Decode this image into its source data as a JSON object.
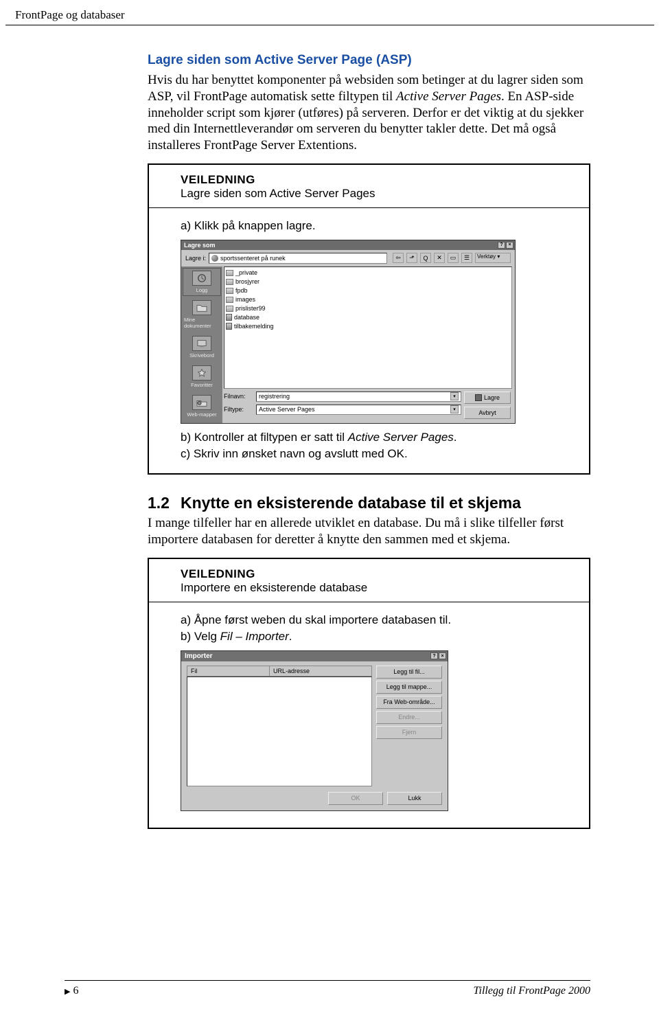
{
  "header": {
    "title": "FrontPage og databaser"
  },
  "section_asp": {
    "title": "Lagre siden som Active Server Page (ASP)",
    "para1_a": "Hvis du har benyttet komponenter på websiden som betinger at du lagrer siden som ASP, vil FrontPage automatisk sette filtypen til ",
    "para1_italic": "Active Server Pages",
    "para1_b": ". En ASP-side inneholder script som kjører (utføres) på serveren. Derfor er det viktig at du sjekker med din Internettleverandør om serveren du benytter takler dette. Det må også installeres FrontPage Server Extentions."
  },
  "box1": {
    "label": "VEILEDNING",
    "subtitle": "Lagre siden som Active Server Pages",
    "step_a": "a)  Klikk på knappen lagre.",
    "step_b_pre": "b)  Kontroller at filtypen er satt til ",
    "step_b_italic": "Active Server Pages",
    "step_b_post": ".",
    "step_c": "c)  Skriv inn ønsket navn og avslutt med OK."
  },
  "save_dialog": {
    "title": "Lagre som",
    "label_lagre_i": "Lagre i:",
    "dropdown_text": "sportssenteret på runek",
    "verktoy": "Verktøy ▾",
    "files": [
      {
        "type": "folder",
        "name": "_private"
      },
      {
        "type": "folder",
        "name": "brosjyrer"
      },
      {
        "type": "folder",
        "name": "fpdb"
      },
      {
        "type": "folder",
        "name": "images"
      },
      {
        "type": "folder",
        "name": "prislister99"
      },
      {
        "type": "db",
        "name": "database"
      },
      {
        "type": "db",
        "name": "tilbakemelding"
      }
    ],
    "sidebar": [
      "Logg",
      "Mine dokumenter",
      "Skrivebord",
      "Favoritter",
      "Web-mapper"
    ],
    "label_filnavn": "Filnavn:",
    "filnavn_value": "registrering",
    "label_filtype": "Filtype:",
    "filtype_value": "Active Server Pages",
    "btn_lagre": "Lagre",
    "btn_avbryt": "Avbryt"
  },
  "section_12": {
    "number": "1.2",
    "title": "Knytte en eksisterende database til et skjema",
    "para": "I mange tilfeller har en allerede utviklet en database. Du må i slike tilfeller først importere databasen for deretter å knytte den sammen med et skjema."
  },
  "box2": {
    "label": "VEILEDNING",
    "subtitle": "Importere en eksisterende database",
    "step_a": "a)  Åpne først weben du skal importere databasen til.",
    "step_b_pre": "b)  Velg ",
    "step_b_italic": "Fil – Importer",
    "step_b_post": "."
  },
  "import_dialog": {
    "title": "Importer",
    "col_fil": "Fil",
    "col_url": "URL-adresse",
    "btn_legg_fil": "Legg til fil...",
    "btn_legg_mappe": "Legg til mappe...",
    "btn_fra_web": "Fra Web-område...",
    "btn_endre": "Endre...",
    "btn_fjern": "Fjern",
    "btn_ok": "OK",
    "btn_lukk": "Lukk"
  },
  "footer": {
    "page": "6",
    "right": "Tillegg til FrontPage 2000"
  }
}
